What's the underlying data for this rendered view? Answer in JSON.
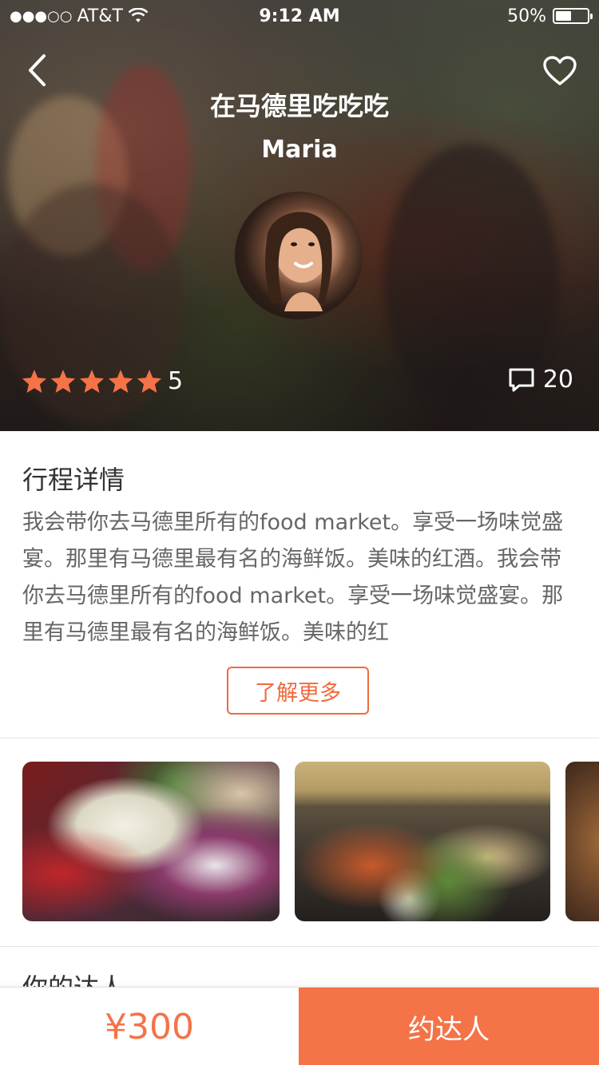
{
  "status_bar": {
    "signal": "●●●○○",
    "carrier": "AT&T",
    "time": "9:12 AM",
    "battery_text": "50%",
    "battery_level": 0.5
  },
  "hero": {
    "title": "在马德里吃吃吃",
    "subtitle": "Maria",
    "rating": {
      "stars": 5,
      "max_stars": 5,
      "value": "5"
    },
    "comments_count": "20",
    "icons": {
      "back": "chevron-left-icon",
      "favorite": "heart-outline-icon",
      "comments": "comment-icon",
      "star": "star-icon"
    },
    "colors": {
      "star": "#f47347"
    }
  },
  "details": {
    "title": "行程详情",
    "body": "我会带你去马德里所有的food market。享受一场味觉盛宴。那里有马德里最有名的海鲜饭。美味的红酒。我会带你去马德里所有的food market。享受一场味觉盛宴。那里有马德里最有名的海鲜饭。美味的红",
    "more_label": "了解更多"
  },
  "guide": {
    "title": "你的达人"
  },
  "bottom_bar": {
    "price": "¥300",
    "book_label": "约达人"
  },
  "colors": {
    "accent": "#f47347",
    "accent_border": "#f06a3c"
  }
}
